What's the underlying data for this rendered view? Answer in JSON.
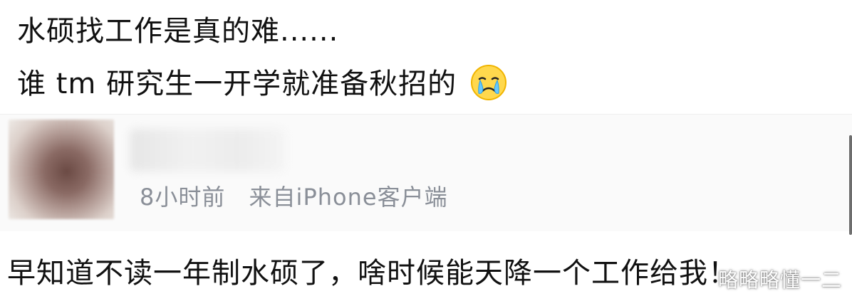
{
  "post": {
    "line1": "水硕找工作是真的难......",
    "line2": "谁 tm 研究生一开学就准备秋招的",
    "emoji": "crying-face-emoji"
  },
  "repost": {
    "time": "8小时前",
    "source": "来自iPhone客户端"
  },
  "comment": {
    "text": "早知道不读一年制水硕了，啥时候能天降一个工作给我！"
  },
  "watermark": {
    "text": "略略略懂一二"
  },
  "colors": {
    "primary_text": "#111111",
    "meta_text": "#8a8f98",
    "background": "#ffffff"
  }
}
